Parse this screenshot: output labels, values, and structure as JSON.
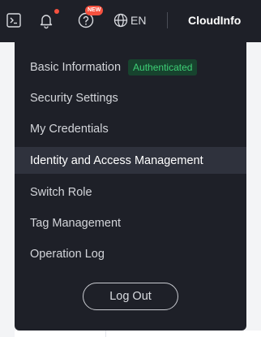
{
  "topbar": {
    "notification_badge": "NEW",
    "language": "EN",
    "account_name": "CloudInfo"
  },
  "menu": {
    "items": [
      {
        "label": "Basic Information",
        "badge": "Authenticated"
      },
      {
        "label": "Security Settings"
      },
      {
        "label": "My Credentials"
      },
      {
        "label": "Identity and Access Management",
        "active": true
      },
      {
        "label": "Switch Role"
      },
      {
        "label": "Tag Management"
      },
      {
        "label": "Operation Log"
      }
    ],
    "logout_label": "Log Out"
  },
  "colors": {
    "topbar_bg": "#1e2028",
    "active_bg": "#2f323d",
    "badge_red": "#f5513f",
    "auth_green": "#3ecf76"
  },
  "icons": [
    "terminal-icon",
    "bell-icon",
    "help-icon",
    "globe-icon"
  ]
}
